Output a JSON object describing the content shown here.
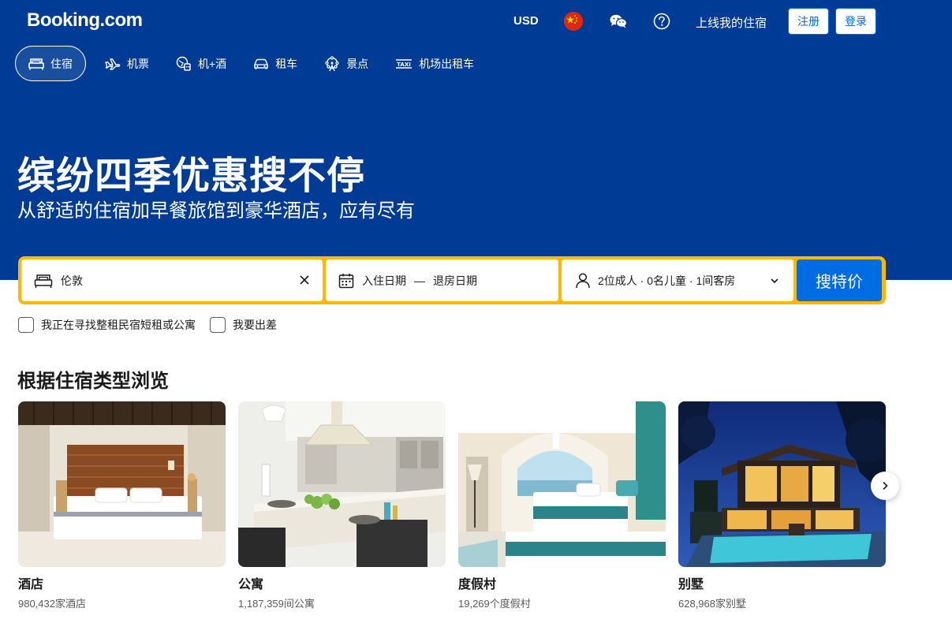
{
  "header": {
    "logo": "Booking.com",
    "currency": "USD",
    "flag_icon": "china-flag-icon",
    "list_property": "上线我的住宿",
    "register_label": "注册",
    "login_label": "登录"
  },
  "tabs": [
    {
      "label": "住宿",
      "icon": "bed-icon",
      "active": true
    },
    {
      "label": "机票",
      "icon": "plane-icon",
      "active": false
    },
    {
      "label": "机+酒",
      "icon": "flight-hotel-icon",
      "active": false
    },
    {
      "label": "租车",
      "icon": "car-icon",
      "active": false
    },
    {
      "label": "景点",
      "icon": "attractions-icon",
      "active": false
    },
    {
      "label": "机场出租车",
      "icon": "taxi-icon",
      "active": false
    }
  ],
  "hero": {
    "title": "缤纷四季优惠搜不停",
    "subtitle": "从舒适的住宿加早餐旅馆到豪华酒店，应有尽有"
  },
  "search": {
    "destination_value": "伦敦",
    "checkin_placeholder": "入住日期",
    "date_separator": "—",
    "checkout_placeholder": "退房日期",
    "guests": "2位成人 · 0名儿童 · 1间客房",
    "search_label": "搜特价"
  },
  "options": {
    "apartments_label": "我正在寻找整租民宿短租或公寓",
    "business_label": "我要出差"
  },
  "section": {
    "title": "根据住宿类型浏览",
    "cards": [
      {
        "name": "酒店",
        "count": "980,432家酒店"
      },
      {
        "name": "公寓",
        "count": "1,187,359间公寓"
      },
      {
        "name": "度假村",
        "count": "19,269个度假村"
      },
      {
        "name": "别墅",
        "count": "628,968家别墅"
      }
    ]
  },
  "colors": {
    "brand_blue": "#003b95",
    "accent_yellow": "#ffb700",
    "action_blue": "#006ce4"
  }
}
